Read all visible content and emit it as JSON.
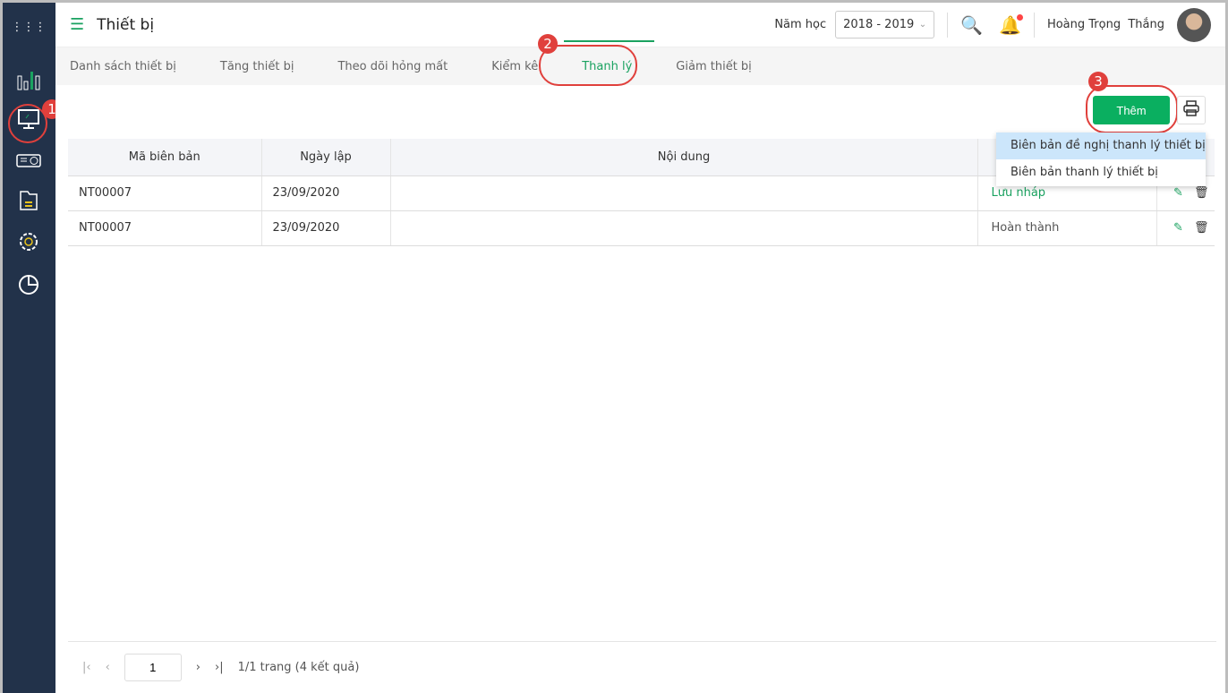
{
  "header": {
    "title": "Thiết bị",
    "year_label": "Năm học",
    "year_value": "2018 - 2019",
    "user_name": "Hoàng Trọng  Thắng"
  },
  "tabs": [
    "Danh sách thiết bị",
    "Tăng thiết bị",
    "Theo dõi hỏng mất",
    "Kiểm kê",
    "Thanh lý",
    "Giảm thiết bị"
  ],
  "annotations": [
    "1",
    "2",
    "3"
  ],
  "toolbar": {
    "add_label": "Thêm"
  },
  "dropdown": [
    "Biên bản đề nghị thanh lý thiết bị",
    "Biên bản thanh lý thiết bị"
  ],
  "table": {
    "headers": [
      "Mã biên bản",
      "Ngày lập",
      "Nội dung",
      ""
    ],
    "rows": [
      {
        "code": "NT00007",
        "date": "23/09/2020",
        "content": "",
        "status": "Lưu nháp"
      },
      {
        "code": "NT00007",
        "date": "23/09/2020",
        "content": "",
        "status": "Hoàn thành"
      }
    ]
  },
  "pager": {
    "page": "1",
    "info": "1/1 trang (4 kết quả)"
  },
  "colors": {
    "accent": "#0aaf60",
    "sidebar": "#22324a",
    "annotation": "#e0403c"
  }
}
